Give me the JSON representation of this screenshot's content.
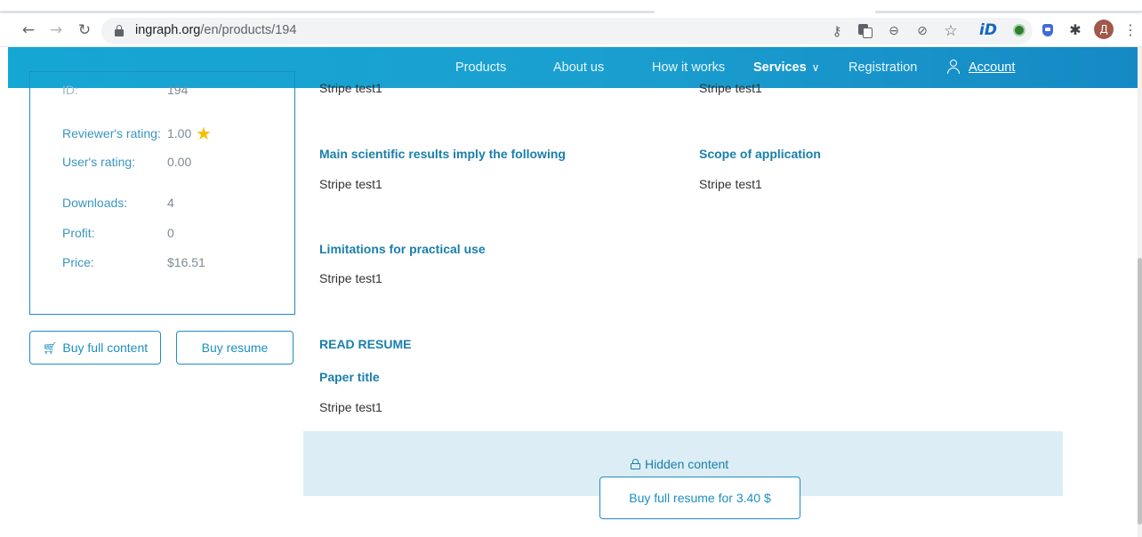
{
  "browser": {
    "url_domain": "ingraph.org",
    "url_path": "/en/products/194",
    "avatar_letter": "Д",
    "extension_id_label": "iD"
  },
  "nav": {
    "items": [
      "Products",
      "About us",
      "How it works",
      "Services",
      "Registration"
    ],
    "services_chevron": "∨",
    "account": "Account"
  },
  "info": {
    "id_label": "ID:",
    "id_value": "194",
    "reviewer_rating_label": "Reviewer's rating:",
    "reviewer_rating_value": "1.00",
    "user_rating_label": "User's rating:",
    "user_rating_value": "0.00",
    "downloads_label": "Downloads:",
    "downloads_value": "4",
    "profit_label": "Profit:",
    "profit_value": "0",
    "price_label": "Price:",
    "price_value": "$16.51"
  },
  "buttons": {
    "buy_full_content": "Buy full content",
    "buy_resume": "Buy resume",
    "buy_full_resume": "Buy full resume for 3.40 $"
  },
  "content": {
    "top_left_text": "Stripe test1",
    "top_right_text": "Stripe test1",
    "main_results_title": "Main scientific results imply the following",
    "main_results_text": "Stripe test1",
    "scope_title": "Scope of application",
    "scope_text": "Stripe test1",
    "limitations_title": "Limitations for practical use",
    "limitations_text": "Stripe test1",
    "read_resume": "READ RESUME",
    "paper_title_label": "Paper title",
    "paper_title_text": "Stripe test1",
    "hidden_content": "Hidden content"
  }
}
